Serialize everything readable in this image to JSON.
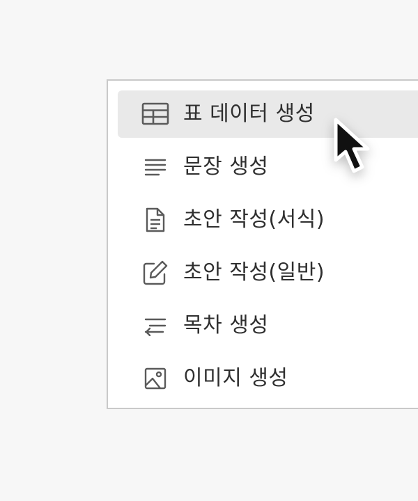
{
  "menu": {
    "items": [
      {
        "label": "표 데이터 생성",
        "icon": "table-icon",
        "active": true
      },
      {
        "label": "문장 생성",
        "icon": "lines-icon",
        "active": false
      },
      {
        "label": "초안 작성(서식)",
        "icon": "document-icon",
        "active": false
      },
      {
        "label": "초안 작성(일반)",
        "icon": "edit-icon",
        "active": false
      },
      {
        "label": "목차 생성",
        "icon": "wrap-icon",
        "active": false
      },
      {
        "label": "이미지 생성",
        "icon": "image-icon",
        "active": false
      }
    ]
  },
  "colors": {
    "background": "#f7f7f7",
    "menu_background": "#ffffff",
    "menu_border": "#c9c9c9",
    "hover_background": "#e9e9e9",
    "text": "#2f2f2f",
    "icon": "#5a5a5a"
  },
  "cursor": {
    "icon": "mouse-pointer-icon"
  }
}
